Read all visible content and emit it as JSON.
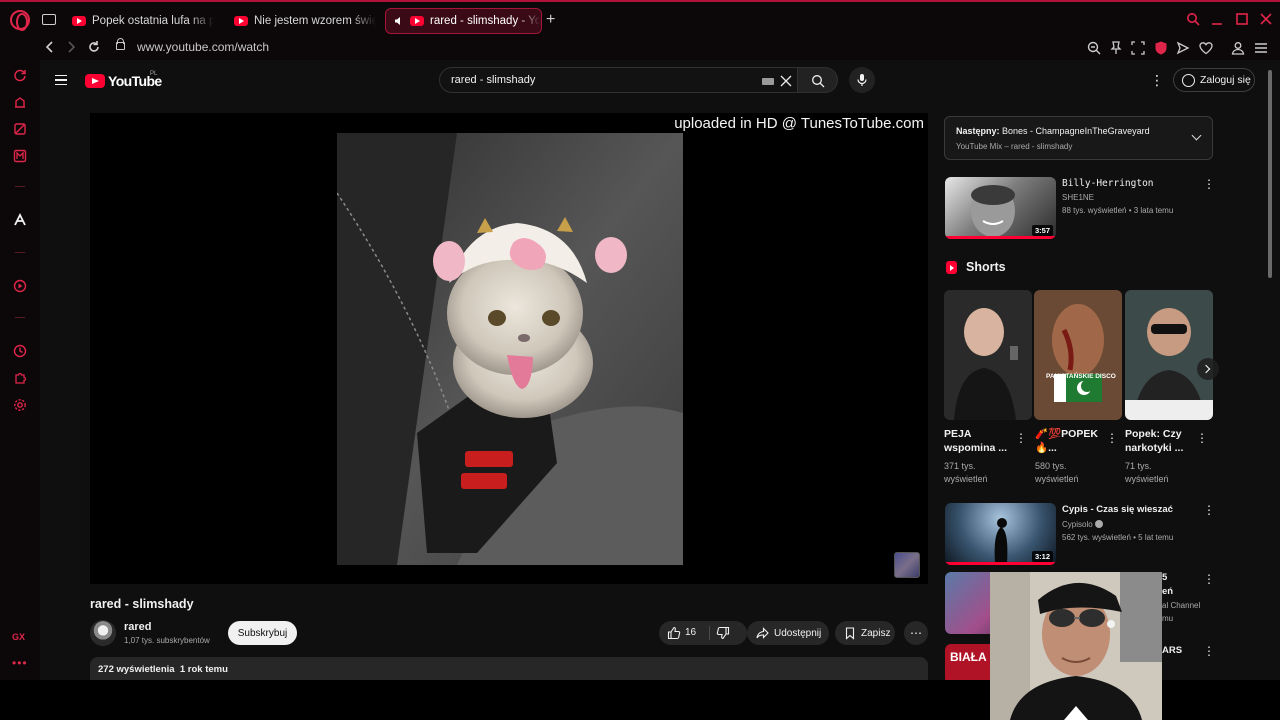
{
  "browser": {
    "tabs": [
      {
        "label": "Popek ostatnia lufa na pyt",
        "active": false
      },
      {
        "label": "Nie jestem wzorem święt",
        "active": false
      },
      {
        "label": "rared - slimshady - Yo",
        "active": true
      }
    ],
    "url": "www.youtube.com/watch",
    "accent_color": "#e0254a"
  },
  "sidebar": {
    "gx_label": "GX",
    "more_label": "•••"
  },
  "youtube": {
    "logo_text": "YouTube",
    "region": "PL",
    "search_value": "rared - slimshady",
    "signin_label": "Zaloguj się",
    "video": {
      "overlay_text": "uploaded in HD @ TunesToTube.com",
      "title": "rared - slimshady",
      "channel": "rared",
      "subscribers": "1,07 tys. subskrybentów",
      "subscribe_label": "Subskrybuj",
      "likes": "16",
      "share_label": "Udostępnij",
      "save_label": "Zapisz",
      "views": "272 wyświetlenia",
      "age": "1 rok temu"
    },
    "up_next": {
      "prefix": "Następny:",
      "title": "Bones - ChampagneInTheGraveyard",
      "source": "YouTube Mix – rared - slimshady"
    },
    "related": [
      {
        "title": "Billy-Herrington",
        "channel": "SHE1NE",
        "meta": "88 tys. wyświetleń • 3 lata temu",
        "duration": "3:57"
      },
      {
        "title": "Cypis - Czas się wieszać",
        "channel": "Cypisolo",
        "meta": "562 tys. wyświetleń • 5 lat temu",
        "duration": "3:12"
      }
    ],
    "partial_items": [
      {
        "fragment": "5"
      },
      {
        "fragment": "eń"
      },
      {
        "fragment": "al Channel"
      },
      {
        "fragment": "mu"
      },
      {
        "fragment": "ARS"
      },
      {
        "fragment": "BIAŁA"
      }
    ],
    "shorts_label": "Shorts",
    "shorts": [
      {
        "title": "PEJA wspomina ...",
        "views": "371 tys. wyświetleń"
      },
      {
        "title": "🧨💯POPEK 🔥...",
        "views": "580 tys. wyświetleń",
        "thumb_caption": "PAKISTAŃSKIE DISCO"
      },
      {
        "title": "Popek: Czy narkotyki ...",
        "views": "71 tys. wyświetleń"
      }
    ]
  }
}
